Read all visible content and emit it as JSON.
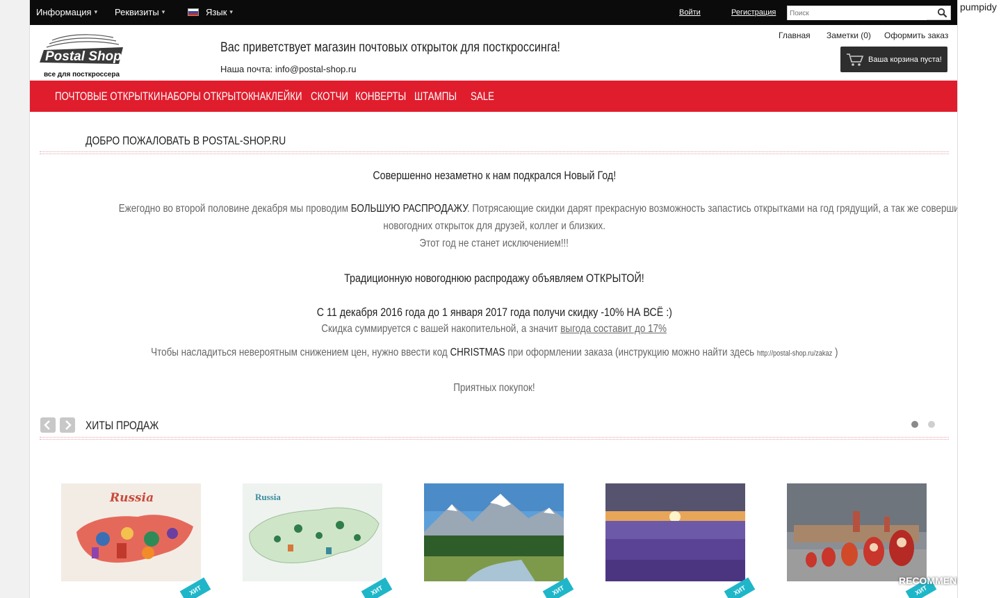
{
  "sidebar_user": "pumpidy",
  "topbar": {
    "menu": [
      {
        "label": "Информация"
      },
      {
        "label": "Реквизиты"
      },
      {
        "label": "Язык"
      }
    ],
    "login_label": "Войти",
    "register_label": "Регистрация",
    "search_placeholder": "Поиск"
  },
  "header": {
    "logo_text": "Postal Shop",
    "logo_tagline": "все для посткроссера",
    "welcome": "Вас приветствует магазин почтовых открыток для посткроссинга!",
    "email_label": "Наша почта:",
    "email": "info@postal-shop.ru",
    "links": [
      "Главная",
      "Заметки (0)",
      "Оформить заказ"
    ],
    "cart_label": "Ваша корзина пуста!"
  },
  "nav": [
    "ПОЧТОВЫЕ ОТКРЫТКИ",
    "НАБОРЫ ОТКРЫТОК",
    "НАКЛЕЙКИ",
    "СКОТЧИ",
    "КОНВЕРТЫ",
    "ШТАМПЫ",
    "SALE"
  ],
  "welcome_section": {
    "title": "ДОБРО ПОЖАЛОВАТЬ В POSTAL-SHOP.RU",
    "headline": "Совершенно незаметно к нам подкрался Новый Год!",
    "p1_before": "Ежегодно во второй половине декабря мы проводим ",
    "p1_strong": "БОЛЬШУЮ РАСПРОДАЖУ",
    "p1_after": ". Потрясающие скидки дарят прекрасную возможность запастись открытками на год грядущий, а так же совершить \"горящую\" покупку",
    "p1_line2": "новогодних открыток для друзей, коллег и близких.",
    "p1_line3": "Этот год не станет исключением!!!",
    "announce": "Традиционную новогоднюю распродажу объявляем ОТКРЫТОЙ!",
    "discount": "С 11 декабря 2016 года до 1 января 2017 года получи скидку -10% НА ВСЁ :)",
    "sum_before": "Скидка суммируется с вашей накопительной, а значит ",
    "sum_link": "выгода составит до 17%",
    "code_before": "Чтобы насладиться невероятным снижением цен, нужно ввести код ",
    "code": "CHRISTMAS",
    "code_after": " при оформлении заказа (инструкцию можно найти здесь ",
    "code_url": "http://postal-shop.ru/zakaz",
    "code_close": " )",
    "thanks": "Приятных покупок!"
  },
  "bestsellers": {
    "title": "ХИТЫ ПРОДАЖ",
    "badge": "ХИТ",
    "products": [
      {
        "name": "russia-folk-map"
      },
      {
        "name": "russia-illustrated-map"
      },
      {
        "name": "mountain-valley"
      },
      {
        "name": "lavender-sunset"
      },
      {
        "name": "kremlin-matryoshka"
      }
    ]
  },
  "watermark": "RECOMMEND.RU",
  "colors": {
    "nav_red": "#e01d2d",
    "topbar": "#0b0b0b",
    "badge": "#1fb6c9"
  }
}
